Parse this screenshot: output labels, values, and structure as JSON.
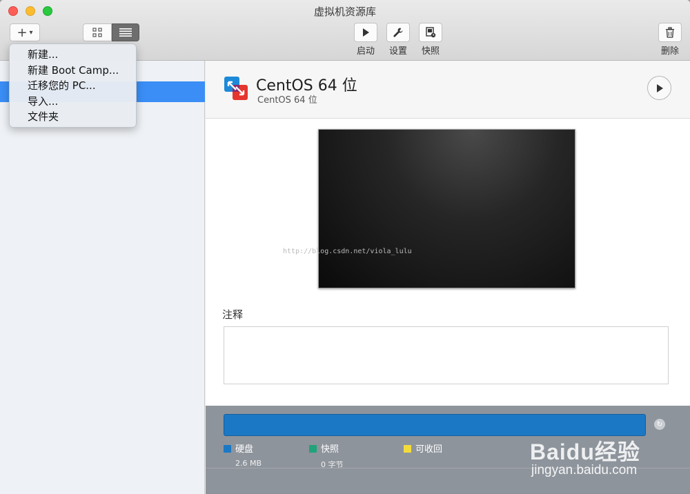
{
  "window": {
    "title": "虚拟机资源库"
  },
  "toolbar": {
    "add_symbol": "+",
    "start_label": "启动",
    "settings_label": "设置",
    "snapshot_label": "快照",
    "delete_label": "删除"
  },
  "add_menu": {
    "items": [
      {
        "label": "新建..."
      },
      {
        "label": "新建 Boot Camp..."
      },
      {
        "label": "迁移您的 PC..."
      },
      {
        "label": "导入..."
      },
      {
        "label": "文件夹"
      }
    ]
  },
  "vm": {
    "name": "CentOS 64 位",
    "subtitle": "CentOS 64 位"
  },
  "screen_watermark": "http://blog.csdn.net/viola_lulu",
  "notes": {
    "label": "注释",
    "value": ""
  },
  "storage": {
    "legend": [
      {
        "label": "硬盘",
        "value": "2.6 MB",
        "color": "#1b78c4"
      },
      {
        "label": "快照",
        "value": "0 字节",
        "color": "#1fa37a"
      },
      {
        "label": "可收回",
        "value": "",
        "color": "#f2dc3c"
      }
    ]
  },
  "baidu_watermark": {
    "brand": "Baidu经验",
    "url": "jingyan.baidu.com"
  },
  "colors": {
    "selection": "#3a8ef6",
    "storage_bar": "#1b78c4"
  }
}
